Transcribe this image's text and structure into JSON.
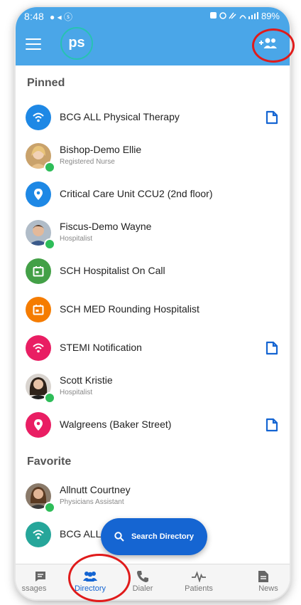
{
  "status": {
    "time": "8:48",
    "icons": "● ◂ ⓢ",
    "right": "89%"
  },
  "header": {
    "logo": "ps"
  },
  "colors": {
    "app_bar": "#4aa6e8",
    "accent": "#1565d2",
    "online": "#2ebd59"
  },
  "sections": {
    "pinned": "Pinned",
    "favorite": "Favorite"
  },
  "pinned": [
    {
      "name": "BCG ALL Physical Therapy",
      "subtitle": "",
      "icon": "wifi-icon",
      "color": "#1e88e5"
    },
    {
      "name": "Bishop-Demo Ellie",
      "subtitle": "Registered Nurse",
      "icon": "avatar"
    },
    {
      "name": "Critical Care Unit CCU2 (2nd floor)",
      "subtitle": "",
      "icon": "location-pin-icon",
      "color": "#1e88e5"
    },
    {
      "name": "Fiscus-Demo Wayne",
      "subtitle": "Hospitalist",
      "icon": "avatar"
    },
    {
      "name": "SCH Hospitalist On Call",
      "subtitle": "",
      "icon": "calendar-icon",
      "color": "#43a047"
    },
    {
      "name": "SCH MED Rounding Hospitalist",
      "subtitle": "",
      "icon": "calendar-icon",
      "color": "#f57c00"
    },
    {
      "name": "STEMI Notification",
      "subtitle": "",
      "icon": "wifi-icon",
      "color": "#e91e63"
    },
    {
      "name": "Scott Kristie",
      "subtitle": "Hospitalist",
      "icon": "avatar"
    },
    {
      "name": "Walgreens (Baker Street)",
      "subtitle": "",
      "icon": "location-pin-icon",
      "color": "#e91e63"
    }
  ],
  "favorite": [
    {
      "name": "Allnutt Courtney",
      "subtitle": "Physicians Assistant",
      "icon": "avatar"
    },
    {
      "name": "BCG ALL",
      "subtitle": "",
      "icon": "wifi-icon",
      "color": "#26a69a"
    }
  ],
  "fab": {
    "label": "Search Directory"
  },
  "tabs": [
    "ssages",
    "Directory",
    "Dialer",
    "Patients",
    "News"
  ]
}
